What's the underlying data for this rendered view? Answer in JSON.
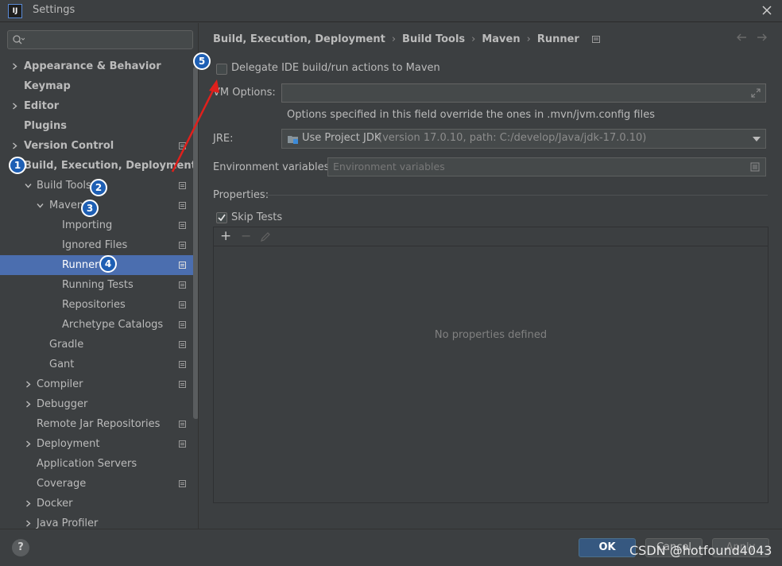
{
  "window": {
    "title": "Settings",
    "app_icon_text": "IJ"
  },
  "search": {
    "placeholder": "Q-",
    "value": ""
  },
  "tree": [
    {
      "label": "Appearance & Behavior",
      "bold": true,
      "arrow": "right",
      "level": 0,
      "modified": false
    },
    {
      "label": "Keymap",
      "bold": true,
      "arrow": "none",
      "level": 0,
      "modified": false
    },
    {
      "label": "Editor",
      "bold": true,
      "arrow": "right",
      "level": 0,
      "modified": false
    },
    {
      "label": "Plugins",
      "bold": true,
      "arrow": "none",
      "level": 0,
      "modified": false
    },
    {
      "label": "Version Control",
      "bold": true,
      "arrow": "right",
      "level": 0,
      "modified": true
    },
    {
      "label": "Build, Execution, Deployment",
      "bold": true,
      "arrow": "down",
      "level": 0,
      "modified": false
    },
    {
      "label": "Build Tools",
      "bold": false,
      "arrow": "down",
      "level": 1,
      "modified": true
    },
    {
      "label": "Maven",
      "bold": false,
      "arrow": "down",
      "level": 2,
      "modified": true
    },
    {
      "label": "Importing",
      "bold": false,
      "arrow": "none",
      "level": 3,
      "modified": true
    },
    {
      "label": "Ignored Files",
      "bold": false,
      "arrow": "none",
      "level": 3,
      "modified": true
    },
    {
      "label": "Runner",
      "bold": false,
      "arrow": "none",
      "level": 3,
      "modified": true,
      "selected": true
    },
    {
      "label": "Running Tests",
      "bold": false,
      "arrow": "none",
      "level": 3,
      "modified": true
    },
    {
      "label": "Repositories",
      "bold": false,
      "arrow": "none",
      "level": 3,
      "modified": true
    },
    {
      "label": "Archetype Catalogs",
      "bold": false,
      "arrow": "none",
      "level": 3,
      "modified": true
    },
    {
      "label": "Gradle",
      "bold": false,
      "arrow": "none",
      "level": 2,
      "modified": true
    },
    {
      "label": "Gant",
      "bold": false,
      "arrow": "none",
      "level": 2,
      "modified": true
    },
    {
      "label": "Compiler",
      "bold": false,
      "arrow": "right",
      "level": 1,
      "modified": true
    },
    {
      "label": "Debugger",
      "bold": false,
      "arrow": "right",
      "level": 1,
      "modified": false
    },
    {
      "label": "Remote Jar Repositories",
      "bold": false,
      "arrow": "none",
      "level": 1,
      "modified": true
    },
    {
      "label": "Deployment",
      "bold": false,
      "arrow": "right",
      "level": 1,
      "modified": true
    },
    {
      "label": "Application Servers",
      "bold": false,
      "arrow": "none",
      "level": 1,
      "modified": false
    },
    {
      "label": "Coverage",
      "bold": false,
      "arrow": "none",
      "level": 1,
      "modified": true
    },
    {
      "label": "Docker",
      "bold": false,
      "arrow": "right",
      "level": 1,
      "modified": false
    },
    {
      "label": "Java Profiler",
      "bold": false,
      "arrow": "right",
      "level": 1,
      "modified": false
    }
  ],
  "badges": [
    "1",
    "2",
    "3",
    "4",
    "5"
  ],
  "breadcrumb": [
    "Build, Execution, Deployment",
    "Build Tools",
    "Maven",
    "Runner"
  ],
  "breadcrumb_separator": "›",
  "runner": {
    "delegate_label": "Delegate IDE build/run actions to Maven",
    "delegate_checked": false,
    "vm_options_label": "VM Options:",
    "vm_options_value": "",
    "vm_hint": "Options specified in this field override the ones in .mvn/jvm.config files",
    "jre_label": "JRE:",
    "jre_value": "Use Project JDK",
    "jre_detail": "(version 17.0.10, path: C:/develop/Java/jdk-17.0.10)",
    "env_label": "Environment variables:",
    "env_placeholder": "Environment variables",
    "properties_label": "Properties:",
    "skip_tests_label": "Skip Tests",
    "skip_tests_checked": true,
    "props_empty": "No properties defined",
    "toolbar": {
      "add": "+",
      "remove": "−"
    }
  },
  "footer": {
    "help": "?",
    "ok": "OK",
    "cancel": "Cancel",
    "apply": "Apply",
    "watermark": "CSDN @hotfound4043"
  },
  "colors": {
    "background": "#3c3f41",
    "selection": "#4b6eaf",
    "badge": "#1e5fb4",
    "annotation_arrow": "#e0201c",
    "ok_button": "#365880"
  }
}
